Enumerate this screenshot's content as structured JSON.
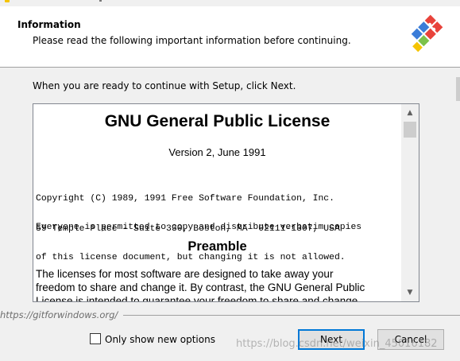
{
  "header": {
    "title": "Information",
    "subtitle": "Please read the following important information before continuing.",
    "logo_icon": "git-logo-icon"
  },
  "intro": "When you are ready to continue with Setup, click Next.",
  "license": {
    "title": "GNU General Public License",
    "version": "Version 2, June 1991",
    "copyright_lines": [
      "Copyright (C) 1989, 1991 Free Software Foundation, Inc.",
      "59 Temple Place - Suite 330, Boston, MA  02111-1307, USA"
    ],
    "permission_lines": [
      "Everyone is permitted to copy and distribute verbatim copies",
      "of this license document, but changing it is not allowed."
    ],
    "preamble_heading": "Preamble",
    "preamble_lines": [
      "  The licenses for most software are designed to take away your",
      "freedom to share and change it. By contrast, the GNU General Public",
      "License is intended to guarantee your freedom to share and change"
    ]
  },
  "footer": {
    "url": "https://gitforwindows.org/",
    "checkbox_label": "Only show new options",
    "checkbox_checked": false,
    "next_label": "Next",
    "cancel_label": "Cancel"
  },
  "watermark": "https://blog.csdn.net/weixin_45016182",
  "colors": {
    "accent": "#0078d7",
    "git_red": "#e8433b",
    "git_blue": "#3b7dd8",
    "git_green": "#7cc24a",
    "git_yellow": "#f5c400"
  }
}
